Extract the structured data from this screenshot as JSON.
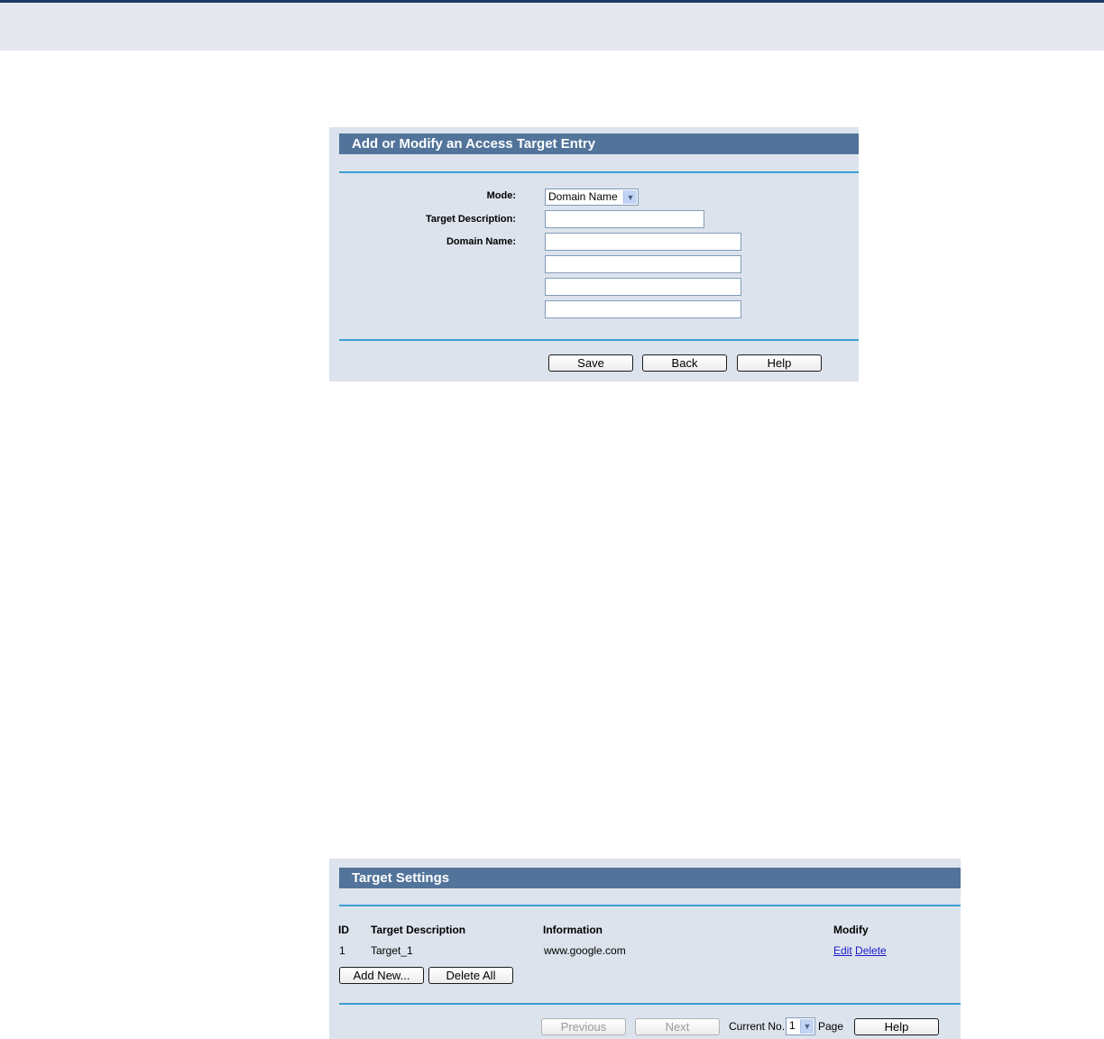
{
  "entry_form": {
    "title": "Add or Modify an Access Target Entry",
    "mode_label": "Mode:",
    "mode_value": "Domain Name",
    "target_description_label": "Target Description:",
    "target_description_value": "",
    "domain_name_label": "Domain Name:",
    "domain_names": [
      "",
      "",
      "",
      ""
    ],
    "save_label": "Save",
    "back_label": "Back",
    "help_label": "Help"
  },
  "target_settings": {
    "title": "Target Settings",
    "columns": [
      "ID",
      "Target Description",
      "Information",
      "Modify"
    ],
    "rows": [
      {
        "id": "1",
        "description": "Target_1",
        "information": "www.google.com",
        "edit_label": "Edit",
        "delete_label": "Delete"
      }
    ],
    "add_new_label": "Add New...",
    "delete_all_label": "Delete All",
    "previous_label": "Previous",
    "next_label": "Next",
    "current_no_label": "Current No.",
    "current_page_value": "1",
    "page_label": "Page",
    "help_label": "Help"
  },
  "icons": {
    "dropdown_arrow": "chevron-down-icon"
  },
  "colors": {
    "header_bar": "#52749a",
    "panel_bg": "#dde3ec",
    "rule": "#3aa0d4",
    "link": "#1a1acc"
  }
}
